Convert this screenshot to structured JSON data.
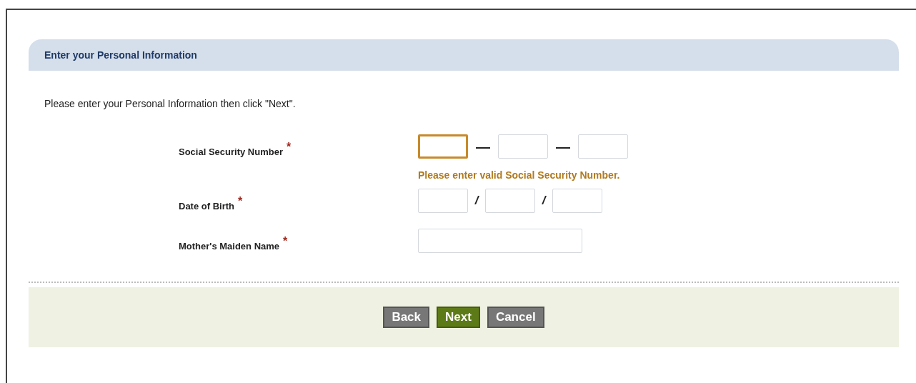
{
  "panel": {
    "title": "Enter your Personal Information"
  },
  "instruction": "Please enter your Personal Information then click \"Next\".",
  "fields": [
    {
      "label": "Social Security Number",
      "required_mark": "*",
      "kind": "ssn",
      "parts": [
        {
          "error": true
        },
        {
          "error": false
        },
        {
          "error": false
        }
      ],
      "separators": [
        "—",
        "—"
      ],
      "error_message": "Please enter valid Social Security Number."
    },
    {
      "label": "Date of Birth",
      "required_mark": "*",
      "kind": "date",
      "parts": [
        {
          "error": false
        },
        {
          "error": false
        },
        {
          "error": false
        }
      ],
      "separators": [
        "/",
        "/"
      ]
    },
    {
      "label": "Mother's Maiden Name",
      "required_mark": "*",
      "kind": "single",
      "parts": [
        {
          "error": false
        }
      ]
    }
  ],
  "buttons": [
    {
      "label": "Back",
      "primary": false
    },
    {
      "label": "Next",
      "primary": true
    },
    {
      "label": "Cancel",
      "primary": false
    }
  ]
}
